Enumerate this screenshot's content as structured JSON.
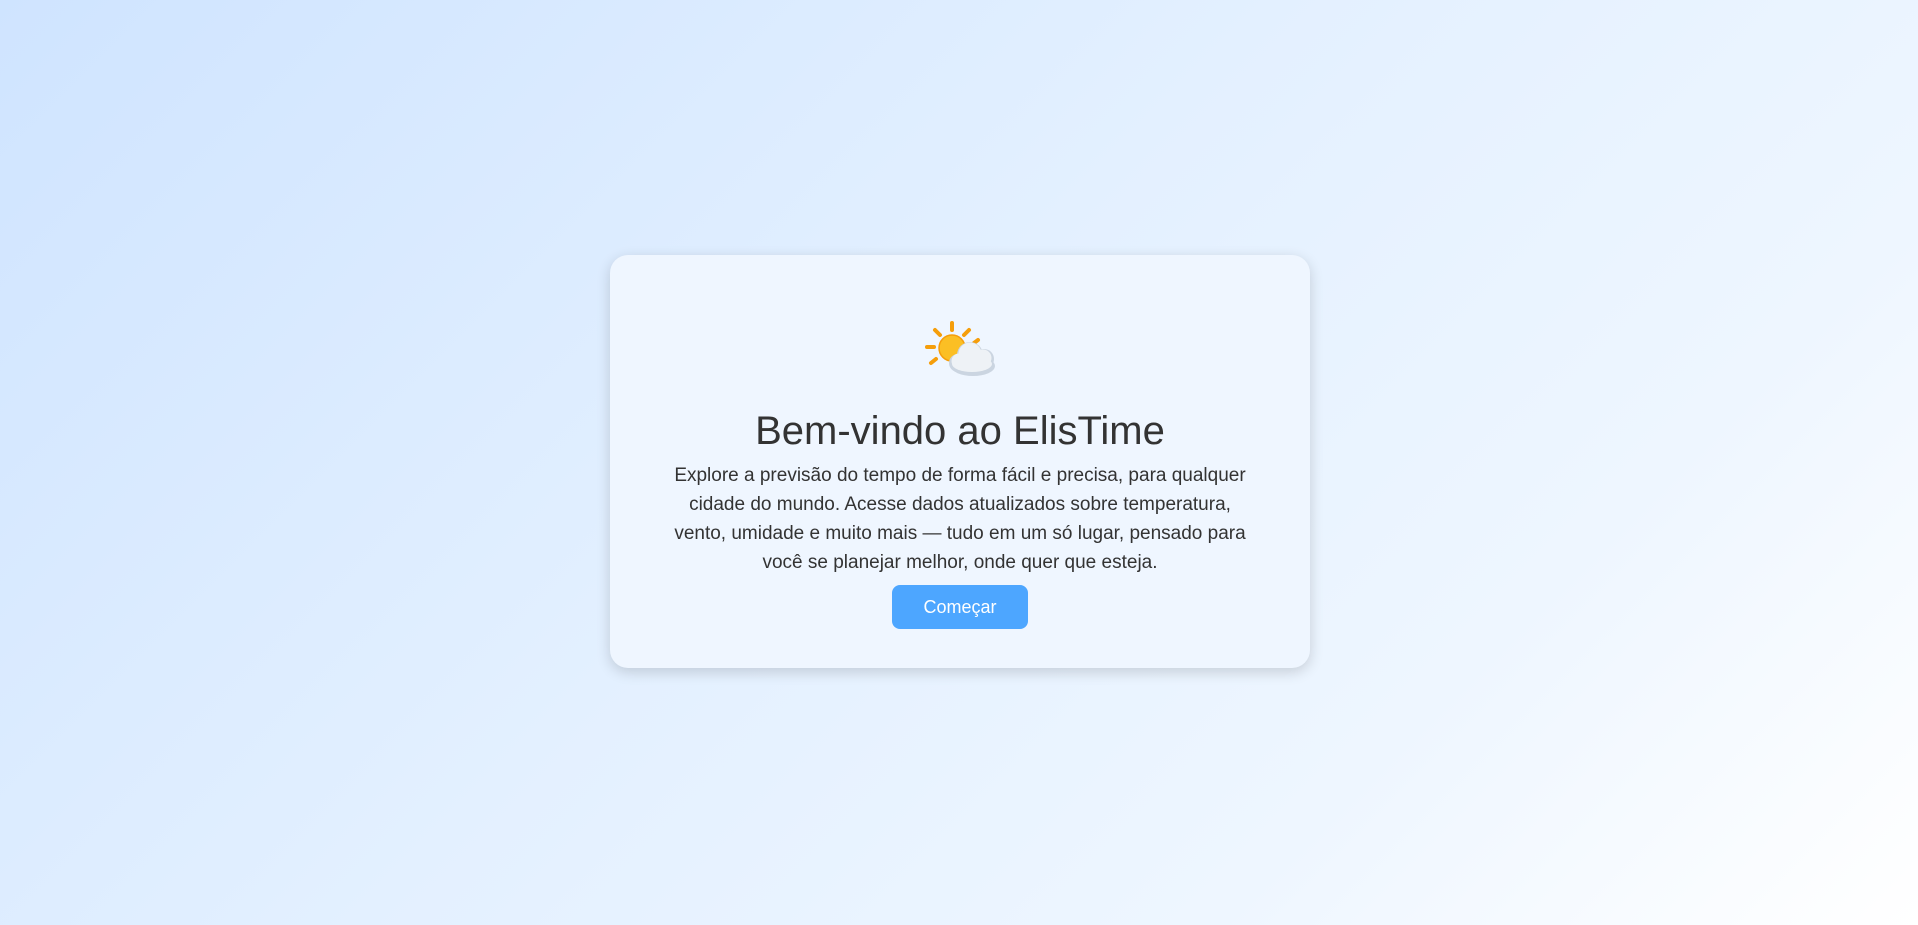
{
  "welcome": {
    "icon": "sun-behind-cloud-icon",
    "title": "Bem-vindo ao ElisTime",
    "description": "Explore a previsão do tempo de forma fácil e precisa, para qualquer cidade do mundo. Acesse dados atualizados sobre temperatura, vento, umidade e muito mais — tudo em um só lugar, pensado para você se planejar melhor, onde quer que esteja.",
    "button_label": "Começar"
  },
  "colors": {
    "accent": "#4da6ff",
    "card_background": "#eff6ff",
    "text": "#333333"
  }
}
